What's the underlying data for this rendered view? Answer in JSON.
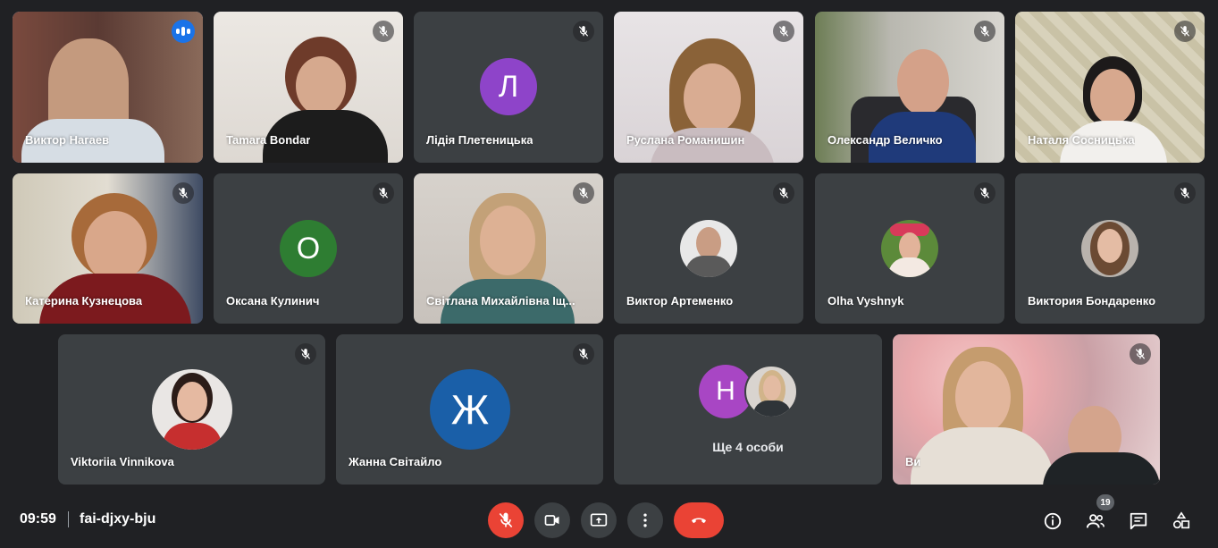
{
  "participants": [
    {
      "name": "Виктор Нагаев"
    },
    {
      "name": "Tamara Bondar"
    },
    {
      "name": "Лідія Плетеницька",
      "initial": "Л"
    },
    {
      "name": "Руслана Романишин"
    },
    {
      "name": "Олександр Величко"
    },
    {
      "name": "Наталя Сосницька"
    },
    {
      "name": "Катерина Кузнецова"
    },
    {
      "name": "Оксана Кулинич",
      "initial": "О"
    },
    {
      "name": "Світлана Михайлівна Іщ..."
    },
    {
      "name": "Виктор Артеменко"
    },
    {
      "name": "Olha Vyshnyk"
    },
    {
      "name": "Виктория Бондаренко"
    },
    {
      "name": "Viktoriia Vinnikova"
    },
    {
      "name": "Жанна Світайло",
      "initial": "Ж"
    },
    {
      "name": "Ви"
    }
  ],
  "more": {
    "initial": "Н",
    "label": "Ще 4 особи"
  },
  "bottombar": {
    "time": "09:59",
    "meeting_code": "fai-djxy-bju",
    "people_count": "19"
  },
  "colors": {
    "background": "#202124",
    "tile": "#3c4043",
    "speaking_outline": "#8ab4f8",
    "end_call": "#ea4335",
    "avatar_purple": "#8e44c9",
    "avatar_green": "#2e7d32",
    "avatar_blue": "#1a5fa8",
    "avatar_magenta": "#a846c4"
  },
  "icons": {
    "mute": "mic-off-icon",
    "speaking": "audio-wave-icon",
    "controls": [
      "mic-off-icon",
      "camera-icon",
      "present-screen-icon",
      "more-vert-icon",
      "hang-up-icon"
    ],
    "right": [
      "info-icon",
      "people-icon",
      "chat-icon",
      "activities-icon"
    ]
  }
}
